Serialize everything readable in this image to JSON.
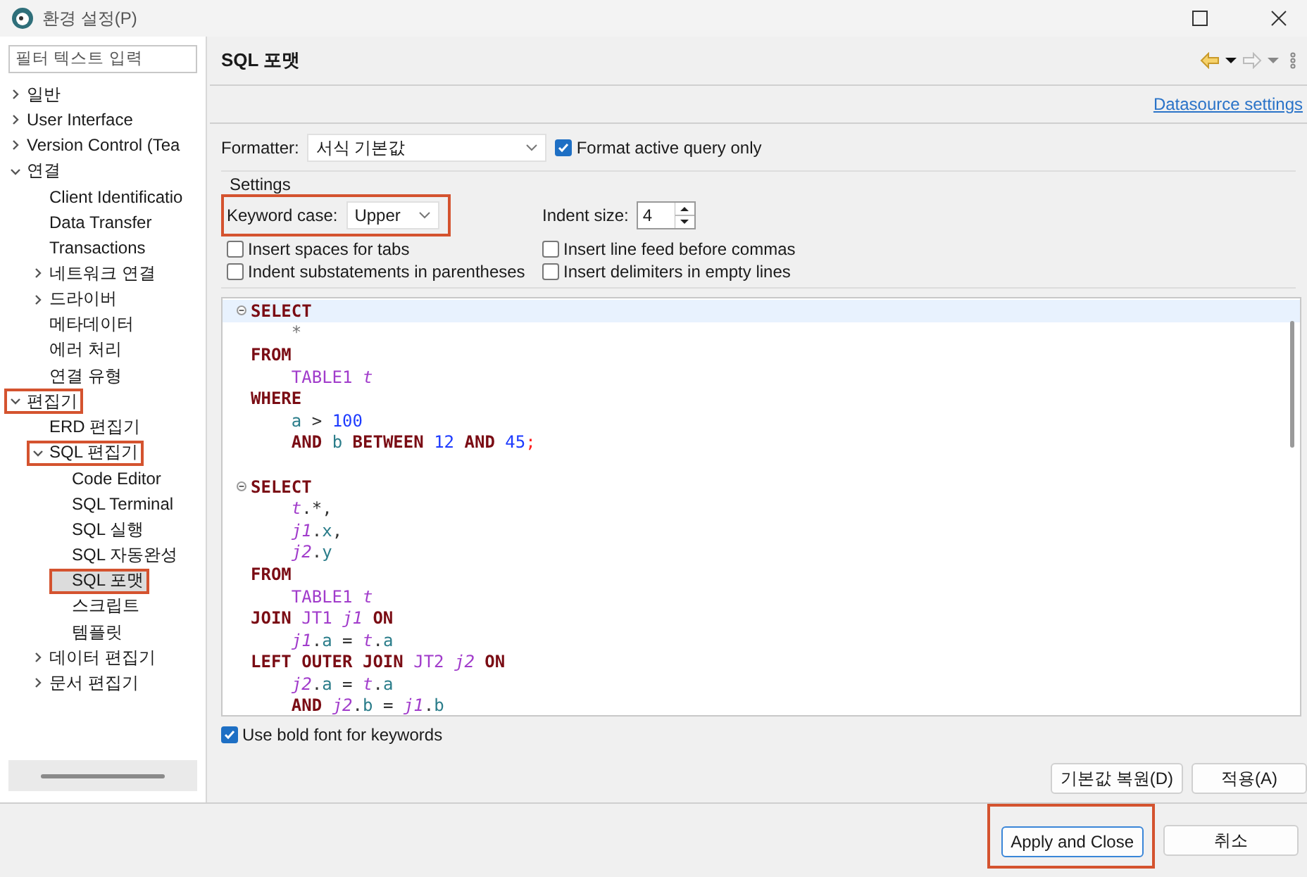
{
  "window": {
    "title": "환경 설정(P)"
  },
  "filter": {
    "placeholder": "필터 텍스트 입력"
  },
  "tree": [
    {
      "label": "일반",
      "expanded": false,
      "selected": false,
      "highlighted": false
    },
    {
      "label": "User Interface",
      "expanded": false,
      "selected": false,
      "highlighted": false
    },
    {
      "label": "Version Control (Tea",
      "expanded": false,
      "selected": false,
      "highlighted": false
    },
    {
      "label": "연결",
      "expanded": true,
      "selected": false,
      "highlighted": false,
      "children": [
        {
          "label": "Client Identificatio",
          "selected": false,
          "highlighted": false
        },
        {
          "label": "Data Transfer",
          "selected": false,
          "highlighted": false
        },
        {
          "label": "Transactions",
          "selected": false,
          "highlighted": false
        },
        {
          "label": "네트워크 연결",
          "expanded": false,
          "selected": false,
          "highlighted": false
        },
        {
          "label": "드라이버",
          "expanded": false,
          "selected": false,
          "highlighted": false
        },
        {
          "label": "메타데이터",
          "selected": false,
          "highlighted": false
        },
        {
          "label": "에러 처리",
          "selected": false,
          "highlighted": false
        },
        {
          "label": "연결 유형",
          "selected": false,
          "highlighted": false
        }
      ]
    },
    {
      "label": "편집기",
      "expanded": true,
      "selected": false,
      "highlighted": true,
      "children": [
        {
          "label": "ERD 편집기",
          "selected": false,
          "highlighted": false
        },
        {
          "label": "SQL 편집기",
          "expanded": true,
          "selected": false,
          "highlighted": true,
          "children": [
            {
              "label": "Code Editor",
              "selected": false,
              "highlighted": false
            },
            {
              "label": "SQL Terminal",
              "selected": false,
              "highlighted": false
            },
            {
              "label": "SQL 실행",
              "selected": false,
              "highlighted": false
            },
            {
              "label": "SQL 자동완성",
              "selected": false,
              "highlighted": false
            },
            {
              "label": "SQL 포맷",
              "selected": true,
              "highlighted": true
            },
            {
              "label": "스크립트",
              "selected": false,
              "highlighted": false
            },
            {
              "label": "템플릿",
              "selected": false,
              "highlighted": false
            }
          ]
        },
        {
          "label": "데이터 편집기",
          "expanded": false,
          "selected": false,
          "highlighted": false
        },
        {
          "label": "문서 편집기",
          "expanded": false,
          "selected": false,
          "highlighted": false
        }
      ]
    }
  ],
  "page": {
    "title": "SQL 포맷",
    "link": "Datasource settings"
  },
  "formatter": {
    "label": "Formatter:",
    "value": "서식 기본값",
    "option": {
      "label": "Format active query only",
      "checked": true
    }
  },
  "settings": {
    "label": "Settings",
    "keyword_case": {
      "label": "Keyword case:",
      "value": "Upper",
      "highlighted": true
    },
    "indent_size": {
      "label": "Indent size:",
      "value": "4"
    },
    "options": [
      {
        "label": "Insert spaces for tabs",
        "checked": false
      },
      {
        "label": "Insert line feed before commas",
        "checked": false
      },
      {
        "label": "Indent substatements in parentheses",
        "checked": false
      },
      {
        "label": "Insert delimiters in empty lines",
        "checked": false
      }
    ]
  },
  "code_lines": [
    {
      "kind": "code",
      "fold": true,
      "indent": false,
      "tokens": [
        {
          "kind": "kw",
          "text": "SELECT"
        }
      ]
    },
    {
      "kind": "code",
      "fold": false,
      "indent": true,
      "tokens": [
        {
          "kind": "star",
          "text": "*"
        }
      ]
    },
    {
      "kind": "code",
      "fold": false,
      "indent": false,
      "tokens": [
        {
          "kind": "kw",
          "text": "FROM"
        }
      ]
    },
    {
      "kind": "code",
      "fold": false,
      "indent": true,
      "tokens": [
        {
          "kind": "tbl",
          "text": "TABLE1 "
        },
        {
          "kind": "alias",
          "text": "t"
        }
      ]
    },
    {
      "kind": "code",
      "fold": false,
      "indent": false,
      "tokens": [
        {
          "kind": "kw",
          "text": "WHERE"
        }
      ]
    },
    {
      "kind": "code",
      "fold": false,
      "indent": true,
      "tokens": [
        {
          "kind": "col",
          "text": "a"
        },
        {
          "kind": "op",
          "text": " > "
        },
        {
          "kind": "num",
          "text": "100"
        }
      ]
    },
    {
      "kind": "code",
      "fold": false,
      "indent": true,
      "tokens": [
        {
          "kind": "kw",
          "text": "AND "
        },
        {
          "kind": "col",
          "text": "b "
        },
        {
          "kind": "kw",
          "text": "BETWEEN "
        },
        {
          "kind": "num",
          "text": "12 "
        },
        {
          "kind": "kw",
          "text": "AND "
        },
        {
          "kind": "num",
          "text": "45"
        },
        {
          "kind": "semi",
          "text": ";"
        }
      ]
    },
    {
      "kind": "blank"
    },
    {
      "kind": "code",
      "fold": true,
      "indent": false,
      "tokens": [
        {
          "kind": "kw",
          "text": "SELECT"
        }
      ]
    },
    {
      "kind": "code",
      "fold": false,
      "indent": true,
      "tokens": [
        {
          "kind": "alias",
          "text": "t"
        },
        {
          "kind": "op",
          "text": ".*,"
        }
      ]
    },
    {
      "kind": "code",
      "fold": false,
      "indent": true,
      "tokens": [
        {
          "kind": "alias",
          "text": "j1"
        },
        {
          "kind": "op",
          "text": "."
        },
        {
          "kind": "col",
          "text": "x"
        },
        {
          "kind": "op",
          "text": ","
        }
      ]
    },
    {
      "kind": "code",
      "fold": false,
      "indent": true,
      "tokens": [
        {
          "kind": "alias",
          "text": "j2"
        },
        {
          "kind": "op",
          "text": "."
        },
        {
          "kind": "col",
          "text": "y"
        }
      ]
    },
    {
      "kind": "code",
      "fold": false,
      "indent": false,
      "tokens": [
        {
          "kind": "kw",
          "text": "FROM"
        }
      ]
    },
    {
      "kind": "code",
      "fold": false,
      "indent": true,
      "tokens": [
        {
          "kind": "tbl",
          "text": "TABLE1 "
        },
        {
          "kind": "alias",
          "text": "t"
        }
      ]
    },
    {
      "kind": "code",
      "fold": false,
      "indent": false,
      "tokens": [
        {
          "kind": "kw",
          "text": "JOIN "
        },
        {
          "kind": "tbl",
          "text": "JT1 "
        },
        {
          "kind": "alias",
          "text": "j1"
        },
        {
          "kind": "kw",
          "text": " ON"
        }
      ]
    },
    {
      "kind": "code",
      "fold": false,
      "indent": true,
      "tokens": [
        {
          "kind": "alias",
          "text": "j1"
        },
        {
          "kind": "op",
          "text": "."
        },
        {
          "kind": "col",
          "text": "a"
        },
        {
          "kind": "op",
          "text": " = "
        },
        {
          "kind": "alias",
          "text": "t"
        },
        {
          "kind": "op",
          "text": "."
        },
        {
          "kind": "col",
          "text": "a"
        }
      ]
    },
    {
      "kind": "code",
      "fold": false,
      "indent": false,
      "tokens": [
        {
          "kind": "kw",
          "text": "LEFT OUTER JOIN "
        },
        {
          "kind": "tbl",
          "text": "JT2 "
        },
        {
          "kind": "alias",
          "text": "j2"
        },
        {
          "kind": "kw",
          "text": " ON"
        }
      ]
    },
    {
      "kind": "code",
      "fold": false,
      "indent": true,
      "tokens": [
        {
          "kind": "alias",
          "text": "j2"
        },
        {
          "kind": "op",
          "text": "."
        },
        {
          "kind": "col",
          "text": "a"
        },
        {
          "kind": "op",
          "text": " = "
        },
        {
          "kind": "alias",
          "text": "t"
        },
        {
          "kind": "op",
          "text": "."
        },
        {
          "kind": "col",
          "text": "a"
        }
      ]
    },
    {
      "kind": "code",
      "fold": false,
      "indent": true,
      "tokens": [
        {
          "kind": "kw",
          "text": "AND "
        },
        {
          "kind": "alias",
          "text": "j2"
        },
        {
          "kind": "op",
          "text": "."
        },
        {
          "kind": "col",
          "text": "b"
        },
        {
          "kind": "op",
          "text": " = "
        },
        {
          "kind": "alias",
          "text": "j1"
        },
        {
          "kind": "op",
          "text": "."
        },
        {
          "kind": "col",
          "text": "b"
        }
      ]
    }
  ],
  "bold_keywords": {
    "label": "Use bold font for keywords",
    "checked": true
  },
  "page_buttons": [
    {
      "label": "기본값 복원(D)"
    },
    {
      "label": "적용(A)"
    }
  ],
  "dialog_buttons": [
    {
      "label": "Apply and Close",
      "default": true,
      "highlighted": true
    },
    {
      "label": "취소",
      "default": false,
      "highlighted": false
    }
  ]
}
